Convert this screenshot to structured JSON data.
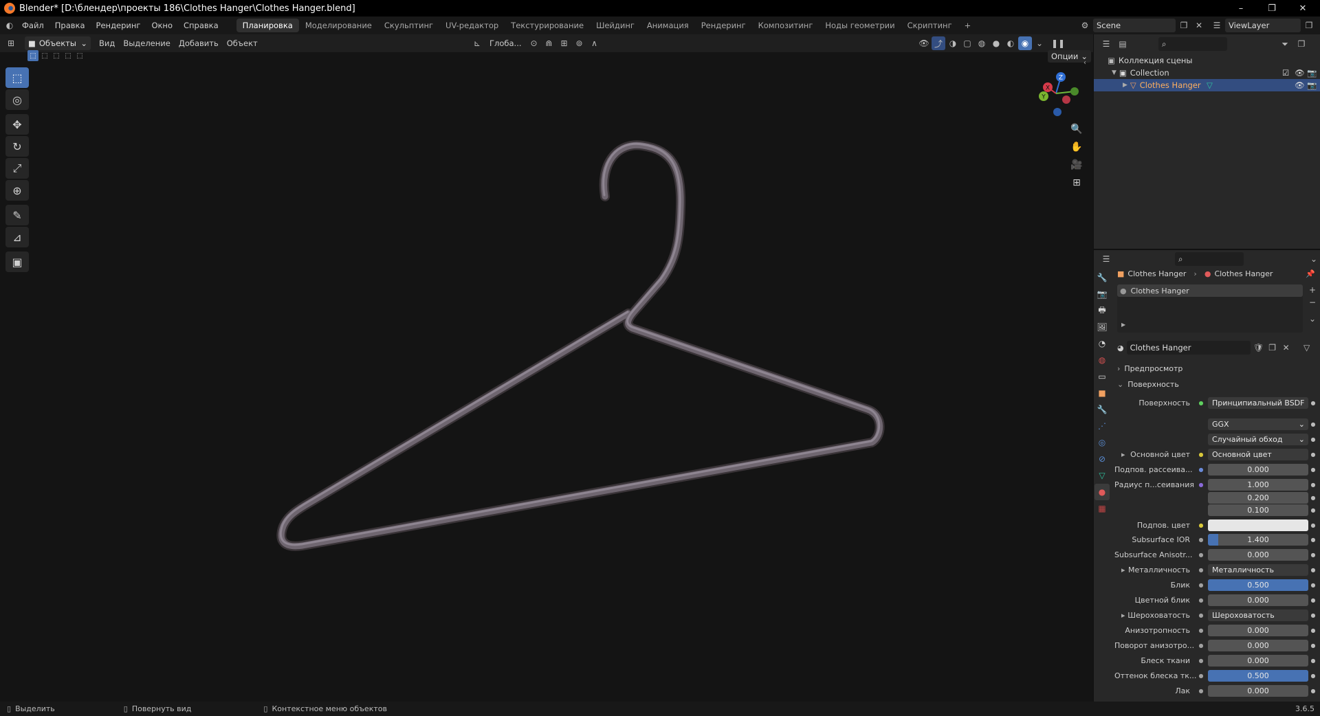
{
  "window": {
    "title": "Blender* [D:\\блендер\\проекты 186\\Clothes Hanger\\Clothes Hanger.blend]",
    "controls": [
      "–",
      "❐",
      "✕"
    ]
  },
  "menu": {
    "items": [
      "Файл",
      "Правка",
      "Рендеринг",
      "Окно",
      "Справка"
    ],
    "workspaces": [
      "Планировка",
      "Моделирование",
      "Скульптинг",
      "UV-редактор",
      "Текстурирование",
      "Шейдинг",
      "Анимация",
      "Рендеринг",
      "Композитинг",
      "Ноды геометрии",
      "Скриптинг"
    ],
    "add_tab": "+",
    "scene": "Scene",
    "view_layer": "ViewLayer"
  },
  "viewport_header": {
    "mode": "Объекты",
    "menus": [
      "Вид",
      "Выделение",
      "Добавить",
      "Объект"
    ],
    "transform_orientation": "Глоба...",
    "options": "Опции"
  },
  "toolbar": {
    "tools": [
      {
        "name": "select-box-tool",
        "glyph": "⬚"
      },
      {
        "name": "cursor-tool",
        "glyph": "◎"
      },
      {
        "name": "move-tool",
        "glyph": "✥"
      },
      {
        "name": "rotate-tool",
        "glyph": "↻"
      },
      {
        "name": "scale-tool",
        "glyph": "⤢"
      },
      {
        "name": "transform-tool",
        "glyph": "⊕"
      },
      {
        "name": "annotate-tool",
        "glyph": "✎"
      },
      {
        "name": "measure-tool",
        "glyph": "📐"
      },
      {
        "name": "add-cube-tool",
        "glyph": "▣"
      }
    ]
  },
  "gizmo": {
    "x": "X",
    "y": "Y",
    "z": "Z"
  },
  "outliner": {
    "root": "Коллекция сцены",
    "collection": "Collection",
    "object": "Clothes Hanger"
  },
  "properties": {
    "breadcrumb_object": "Clothes Hanger",
    "breadcrumb_material": "Clothes Hanger",
    "slot": "Clothes Hanger",
    "material_name": "Clothes Hanger",
    "panel_preview": "Предпросмотр",
    "panel_surface": "Поверхность",
    "rows": [
      {
        "label": "Поверхность",
        "value": "Принципиальный BSDF",
        "style": "dark",
        "dot": "green"
      },
      {
        "label": "",
        "value": "GGX",
        "style": "dropdown"
      },
      {
        "label": "",
        "value": "Случайный обход",
        "style": "dropdown"
      },
      {
        "label": "Основной цвет",
        "value": "Основной цвет",
        "style": "dark",
        "dot": "yellow",
        "expand": true
      },
      {
        "label": "Подпов. рассеива...",
        "value": "0.000",
        "dot": "blue"
      },
      {
        "label": "Радиус п...сеивания",
        "value": "1.000",
        "dot": "purple"
      },
      {
        "label": "",
        "value": "0.200"
      },
      {
        "label": "",
        "value": "0.100"
      },
      {
        "label": "Подпов. цвет",
        "value": "",
        "style": "white",
        "dot": "yellow"
      },
      {
        "label": "Subsurface IOR",
        "value": "1.400",
        "fill": 0.1,
        "dot": "grey"
      },
      {
        "label": "Subsurface Anisotr...",
        "value": "0.000",
        "dot": "grey"
      },
      {
        "label": "Металличность",
        "value": "Металличность",
        "style": "dark",
        "dot": "grey",
        "expand": true
      },
      {
        "label": "Блик",
        "value": "0.500",
        "fill": 1.0,
        "dot": "grey"
      },
      {
        "label": "Цветной блик",
        "value": "0.000",
        "dot": "grey"
      },
      {
        "label": "Шероховатость",
        "value": "Шероховатость",
        "style": "dark",
        "dot": "grey",
        "expand": true
      },
      {
        "label": "Анизотропность",
        "value": "0.000",
        "dot": "grey"
      },
      {
        "label": "Поворот анизотро...",
        "value": "0.000",
        "dot": "grey"
      },
      {
        "label": "Блеск ткани",
        "value": "0.000",
        "dot": "grey"
      },
      {
        "label": "Оттенок блеска тк...",
        "value": "0.500",
        "fill": 1.0,
        "dot": "grey"
      },
      {
        "label": "Лак",
        "value": "0.000",
        "dot": "grey"
      }
    ]
  },
  "status": {
    "select": "Выделить",
    "rotate": "Повернуть вид",
    "context": "Контекстное меню объектов",
    "version": "3.6.5"
  },
  "colors": {
    "accent": "#4772b3",
    "hanger": "#6f6670",
    "viewport_bg": "#141414"
  }
}
